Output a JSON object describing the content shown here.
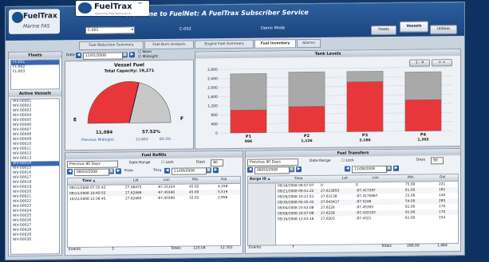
{
  "logo_top": {
    "name": "FuelTrax",
    "tm": "TM",
    "tagline": "Optimizing Fleet Performance"
  },
  "logo": {
    "name": "FuelTrax",
    "sub": "Marine FAS"
  },
  "header": {
    "welcome": "Welcome to FuelNet: A FuelTrax Subscriber Service",
    "vessel_select": "C-002",
    "vessel_name": "C-002",
    "mode": "Demo Mode",
    "btn_fleets": "Fleets",
    "btn_vessels": "Vessels",
    "btn_utilities": "Utilities"
  },
  "tabs": [
    "Fuel Reduction Summary",
    "Fuel Burn Analysis",
    "Engine Fuel Summary",
    "Fuel Inventory",
    "Alarms"
  ],
  "fleets": {
    "title": "Fleets",
    "items": [
      "FL-001",
      "FL-002",
      "FL-003"
    ]
  },
  "active_vessels": {
    "title": "Active Vessels",
    "items": [
      "WV-00001",
      "WV-00002",
      "WV-00003",
      "WV-00004",
      "WV-00005",
      "WV-00006",
      "WV-00007",
      "WV-00008",
      "WV-00009",
      "WV-00010",
      "WV-00011",
      "WV-00012",
      "WV-00013",
      "WV-00014",
      "WV-00015",
      "WV-00016",
      "WV-00017",
      "WV-00018",
      "WV-00019",
      "WV-00020",
      "WV-00021",
      "WV-00022",
      "WV-00023",
      "WV-00024",
      "WV-00025",
      "WV-00026",
      "WV-00027",
      "WV-00028",
      "WV-00029",
      "WV-00030"
    ],
    "selected_index": 13
  },
  "date_bar": {
    "label": "Date",
    "value": "11/01/2008",
    "noon": "Noon",
    "midnight": "Midnight"
  },
  "vessel_fuel": {
    "title": "Vessel Fuel",
    "capacity": "Total Capacity: 19,271",
    "e": "E",
    "f": "F",
    "current": "11,084",
    "percent": "57.52%",
    "prev_label": "Previous Midnight:",
    "prev_value": "11,663",
    "prev_percent": "60.3%",
    "fill_fraction": 0.5752
  },
  "tank_levels": {
    "title": "Tank Levels",
    "paging": "1 - 4"
  },
  "chart_data": {
    "type": "bar",
    "title": "Tank Levels",
    "categories": [
      "P1",
      "P2",
      "P3",
      "P4"
    ],
    "tank_values": [
      "996",
      "1,126",
      "2,186",
      "1,365"
    ],
    "capacities": [
      2600,
      2650,
      2650,
      2600
    ],
    "values": [
      1000,
      1130,
      2190,
      1370
    ],
    "yticks": [
      "2,800",
      "2,400",
      "2,000",
      "1,600",
      "1,200",
      "800",
      "400",
      "0"
    ],
    "ylim": [
      0,
      2800
    ],
    "colors": {
      "fuel": "#e8373b",
      "empty": "#a9a9a9"
    }
  },
  "refills": {
    "title": "Fuel Refills",
    "range": "Previous 90 Days",
    "date_range": "Date Range",
    "lock": "Lock",
    "days_label": "Days",
    "days": "90",
    "from_date": "08/03/2008",
    "from": "From",
    "thru": "Thru",
    "thru_date": "11/08/2008",
    "cols": [
      "Time",
      "Lat",
      "Lon",
      "Min",
      "Gal"
    ],
    "rows": [
      [
        "09/11/2008 07:35:42",
        "27.46475",
        "-97.25154",
        "45.02",
        "4,258"
      ],
      [
        "09/11/2008 18:40:55",
        "27.62466",
        "-97.45590",
        "45.00",
        "5,519"
      ],
      [
        "10/22/2008 12:38:45",
        "27.62465",
        "-97.45590",
        "32.02",
        "2,956"
      ]
    ],
    "events_label": "Events",
    "events": "3",
    "totals_label": "Totals",
    "total_min": "120.04",
    "total_gal": "12,701"
  },
  "transfers": {
    "title": "Fuel Transfers",
    "range": "Previous 90 Days",
    "date_range": "Date Range",
    "lock": "Lock",
    "days_label": "Days",
    "days": "90",
    "from_date": "08/03/2008",
    "thru_date": "11/08/2008",
    "cols": [
      "Barge ID",
      "Time",
      "Lat",
      "Lon",
      "Min",
      "Gal"
    ],
    "rows": [
      [
        "",
        "09/16/2008 09:57:07",
        "0",
        "0",
        "75.00",
        "221"
      ],
      [
        "",
        "09/21/2008 09:51:22",
        "27.613855",
        "-97.417267",
        "61.00",
        "181"
      ],
      [
        "",
        "09/26/2008 10:21:51",
        "27.61138",
        "-97.4170067",
        "23.00",
        "140"
      ],
      [
        "",
        "09/30/2008 05:35:32",
        "27.643417",
        "-97.5246",
        "54.00",
        "285"
      ],
      [
        "",
        "09/04/2008 23:52:08",
        "27.6226",
        "-97.45305",
        "61.00",
        "170"
      ],
      [
        "",
        "09/08/2008 20:57:08",
        "27.6226",
        "-97.432103",
        "91.00",
        "170"
      ],
      [
        "",
        "09/16/2008 12:53:16",
        "27.6203",
        "-97.4321",
        "61.00",
        "154"
      ]
    ],
    "events_label": "Events",
    "events": "7",
    "totals_label": "Totals",
    "total_min": "288.00",
    "total_gal": "1,464"
  }
}
